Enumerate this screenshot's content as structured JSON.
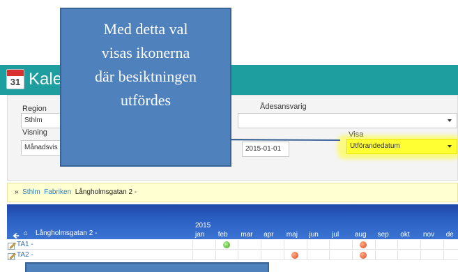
{
  "header": {
    "title": "Kalender",
    "icon_number": "31"
  },
  "filters": {
    "region_label": "Region",
    "region_value": "Sthlm",
    "responsible_label": "Ådesansvarig",
    "responsible_value": "",
    "visning_label": "Visning",
    "visning_value": "Månadsvis",
    "date_value": "2015-01-01",
    "visa_label": "Visa",
    "visa_value": "Utförandedatum"
  },
  "breadcrumb": {
    "prefix": "»",
    "link1": "Sthlm",
    "link2": "Fabriken",
    "text": "Långholmsgatan 2 -"
  },
  "grid": {
    "title": "Långholmsgatan 2 -",
    "year": "2015",
    "months": [
      "jan",
      "feb",
      "mar",
      "apr",
      "maj",
      "jun",
      "jul",
      "aug",
      "sep",
      "okt",
      "nov",
      "de"
    ],
    "rows": [
      {
        "label": "TA1 -",
        "marks": [
          {
            "month": "feb",
            "status": "green"
          },
          {
            "month": "aug",
            "status": "red"
          }
        ]
      },
      {
        "label": "TA2 -",
        "marks": [
          {
            "month": "maj",
            "status": "red"
          },
          {
            "month": "aug",
            "status": "red"
          }
        ]
      }
    ]
  },
  "callout": {
    "line1": "Med detta val",
    "line2": "visas ikonerna",
    "line3": "där besiktningen",
    "line4": "utfördes"
  },
  "colors": {
    "header": "#1f9ea0",
    "callout": "#4f81bd",
    "highlight": "#ffff33",
    "grid_header": "#2a5fc2"
  }
}
